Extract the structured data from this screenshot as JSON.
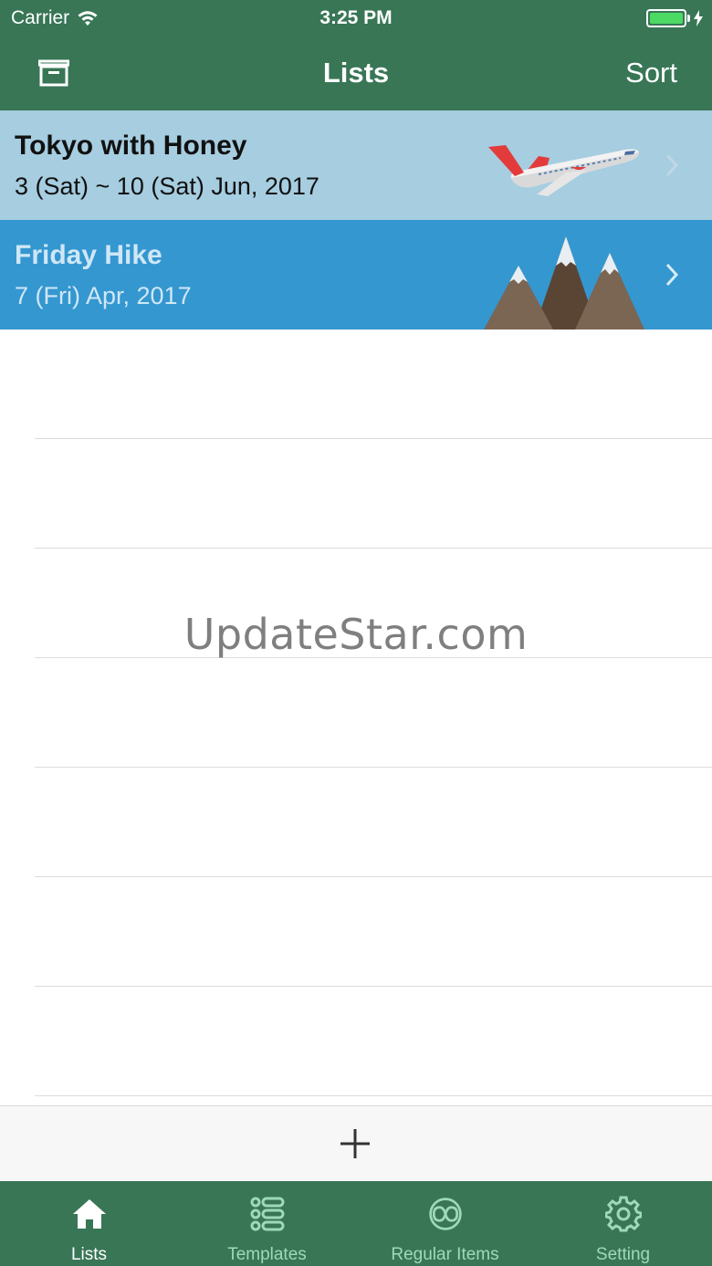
{
  "status_bar": {
    "carrier": "Carrier",
    "time": "3:25 PM"
  },
  "nav": {
    "title": "Lists",
    "sort_label": "Sort",
    "archive_icon": "archive-box-icon"
  },
  "lists": [
    {
      "title": "Tokyo with Honey",
      "date": "3 (Sat) ~ 10 (Sat) Jun, 2017",
      "image": "airplane-icon",
      "bg": "#a6cde0"
    },
    {
      "title": "Friday Hike",
      "date": "7 (Fri) Apr, 2017",
      "image": "mountains-icon",
      "bg": "#3497d0"
    }
  ],
  "watermark": "UpdateStar.com",
  "add_bar": {
    "icon": "plus-icon"
  },
  "tabs": [
    {
      "label": "Lists",
      "icon": "home-icon",
      "active": true
    },
    {
      "label": "Templates",
      "icon": "list-template-icon",
      "active": false
    },
    {
      "label": "Regular Items",
      "icon": "infinity-link-icon",
      "active": false
    },
    {
      "label": "Setting",
      "icon": "gear-icon",
      "active": false
    }
  ],
  "colors": {
    "primary": "#387656",
    "tab_inactive": "#9fd9b8",
    "battery": "#4cd964"
  }
}
